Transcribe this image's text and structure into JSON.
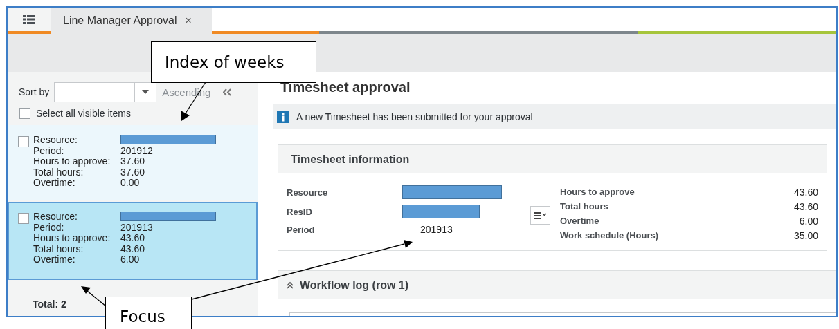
{
  "tabs": [
    {
      "label": "Line Manager Approval",
      "selected": true,
      "close": "×"
    }
  ],
  "sidebar": {
    "sort_label": "Sort by",
    "sort_order": "Ascending",
    "select_all": {
      "label": "Select all visible items",
      "checked": false
    },
    "items": [
      {
        "selected": false,
        "checked": false,
        "fields": [
          {
            "label": "Resource:",
            "redacted": true
          },
          {
            "label": "Period:",
            "value": "201912"
          },
          {
            "label": "Hours to approve:",
            "value": "37.60"
          },
          {
            "label": "Total hours:",
            "value": "37.60"
          },
          {
            "label": "Overtime:",
            "value": "0.00"
          }
        ]
      },
      {
        "selected": true,
        "checked": false,
        "fields": [
          {
            "label": "Resource:",
            "redacted": true
          },
          {
            "label": "Period:",
            "value": "201913"
          },
          {
            "label": "Hours to approve:",
            "value": "43.60"
          },
          {
            "label": "Total hours:",
            "value": "43.60"
          },
          {
            "label": "Overtime:",
            "value": "6.00"
          }
        ]
      }
    ],
    "total": "Total: 2"
  },
  "main": {
    "title": "Timesheet approval",
    "notice": "A new Timesheet has been submitted for your approval",
    "info_panel": {
      "title": "Timesheet information",
      "left_fields": [
        {
          "label": "Resource",
          "redacted": true
        },
        {
          "label": "ResID",
          "redacted": true
        },
        {
          "label": "Period",
          "value": "201913"
        }
      ],
      "right_fields": [
        {
          "label": "Hours to approve",
          "value": "43.60"
        },
        {
          "label": "Total hours",
          "value": "43.60"
        },
        {
          "label": "Overtime",
          "value": "6.00"
        },
        {
          "label": "Work schedule (Hours)",
          "value": "35.00"
        }
      ]
    },
    "workflow_panel": {
      "title": "Workflow log (row 1)",
      "expanded": true
    }
  },
  "annotations": [
    {
      "kind": "index",
      "text": "Index of weeks"
    },
    {
      "kind": "focus",
      "text": "Focus"
    }
  ]
}
